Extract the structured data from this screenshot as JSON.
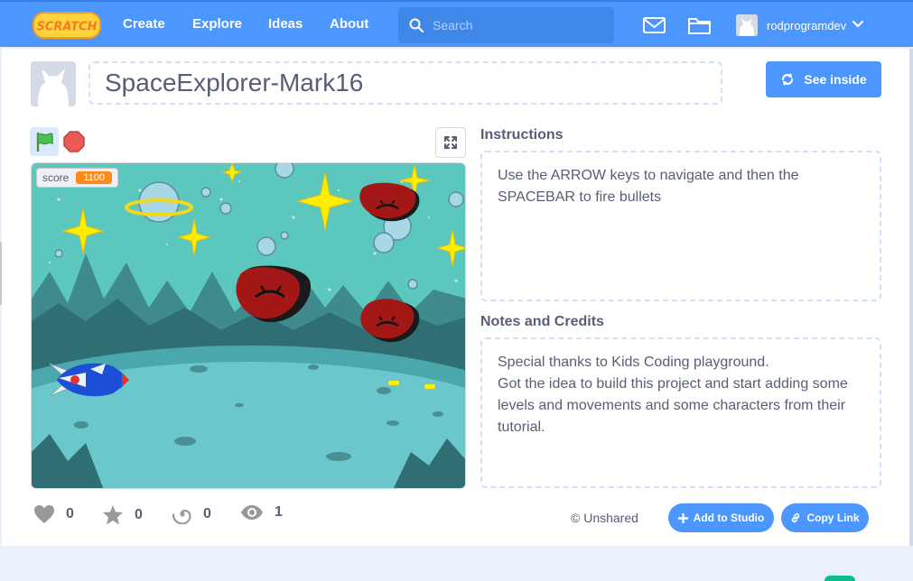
{
  "nav": {
    "logo": "SCRATCH",
    "links": [
      "Create",
      "Explore",
      "Ideas",
      "About"
    ],
    "search_placeholder": "Search",
    "username": "rodprogramdev"
  },
  "project": {
    "title": "SpaceExplorer-Mark16",
    "see_inside_label": "See inside"
  },
  "stage": {
    "monitor_label": "score",
    "monitor_value": "1100"
  },
  "instructions": {
    "heading": "Instructions",
    "text": "Use the ARROW keys to navigate and then the\nSPACEBAR to fire bullets"
  },
  "notes": {
    "heading": "Notes and Credits",
    "text": "Special thanks to Kids Coding playground.\nGot the idea to build this project and start adding some\nlevels and movements and some characters from their\ntutorial."
  },
  "stats": {
    "loves": "0",
    "favorites": "0",
    "remixes": "0",
    "views": "1"
  },
  "sharing": {
    "status": "© Unshared",
    "add_to_studio_label": "Add to Studio",
    "copy_link_label": "Copy Link"
  },
  "colors": {
    "brand": "#4c97ff",
    "monitor": "#ff8c1a",
    "stage_sky": "#5cc8bd",
    "meteor": "#a31717"
  }
}
